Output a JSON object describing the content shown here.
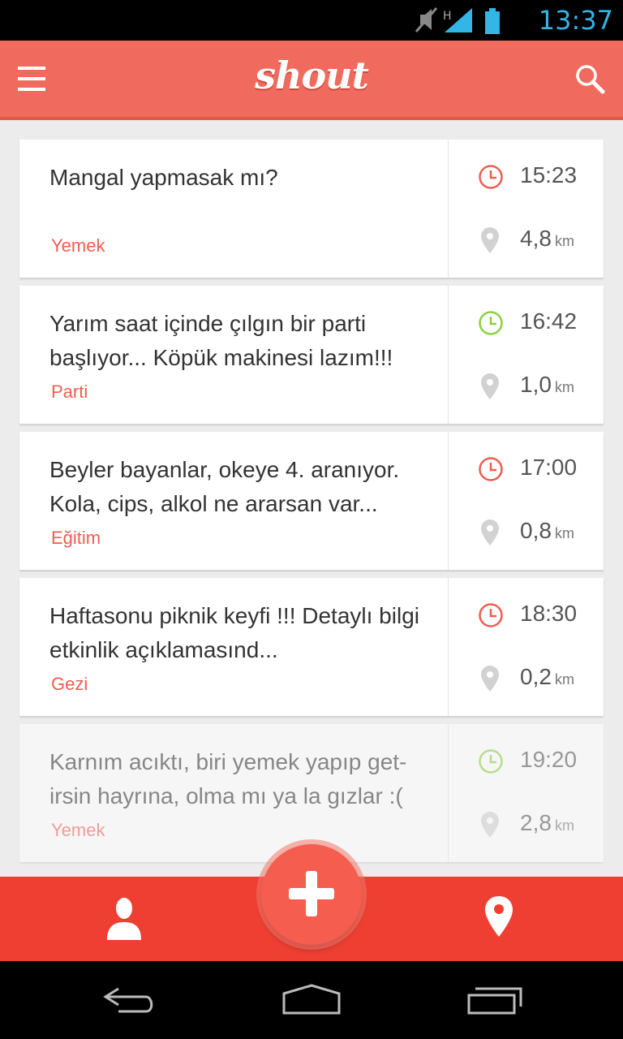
{
  "status_bar": {
    "time": "13:37",
    "network": "H"
  },
  "app_bar": {
    "logo": "shout"
  },
  "colors": {
    "accent": "#f06b5d",
    "bottom_bar": "#ef3f33",
    "status_red": "#ef5d51",
    "status_green": "#8ad13f"
  },
  "posts": [
    {
      "text": "Mangal yapmasak mı?",
      "category": "Yemek",
      "time": "15:23",
      "time_status": "red",
      "distance": "4,8",
      "unit": "km"
    },
    {
      "text": "Yarım saat içinde çılgın bir parti başlıyor... Köpük makinesi lazım!!!",
      "category": "Parti",
      "time": "16:42",
      "time_status": "green",
      "distance": "1,0",
      "unit": "km"
    },
    {
      "text": "Beyler bayanlar, okeye 4. aranıyor. Kola, cips, alkol ne ararsan var...",
      "category": "Eğitim",
      "time": "17:00",
      "time_status": "red",
      "distance": "0,8",
      "unit": "km"
    },
    {
      "text": "Haftasonu piknik keyfi !!! Detaylı bilgi etkinlik açıklamasınd...",
      "category": "Gezi",
      "time": "18:30",
      "time_status": "red",
      "distance": "0,2",
      "unit": "km"
    },
    {
      "text": "Karnım acıktı, biri yemek yapıp get-irsin hayrına, olma mı ya la gızlar :(",
      "category": "Yemek",
      "time": "19:20",
      "time_status": "green",
      "distance": "2,8",
      "unit": "km"
    }
  ],
  "icons": {
    "menu": "hamburger-icon",
    "search": "search-icon",
    "clock": "clock-icon",
    "pin": "map-pin-icon",
    "profile": "person-icon",
    "location": "location-icon",
    "add": "plus-icon",
    "back": "back-icon",
    "home": "home-icon",
    "recents": "recents-icon"
  }
}
